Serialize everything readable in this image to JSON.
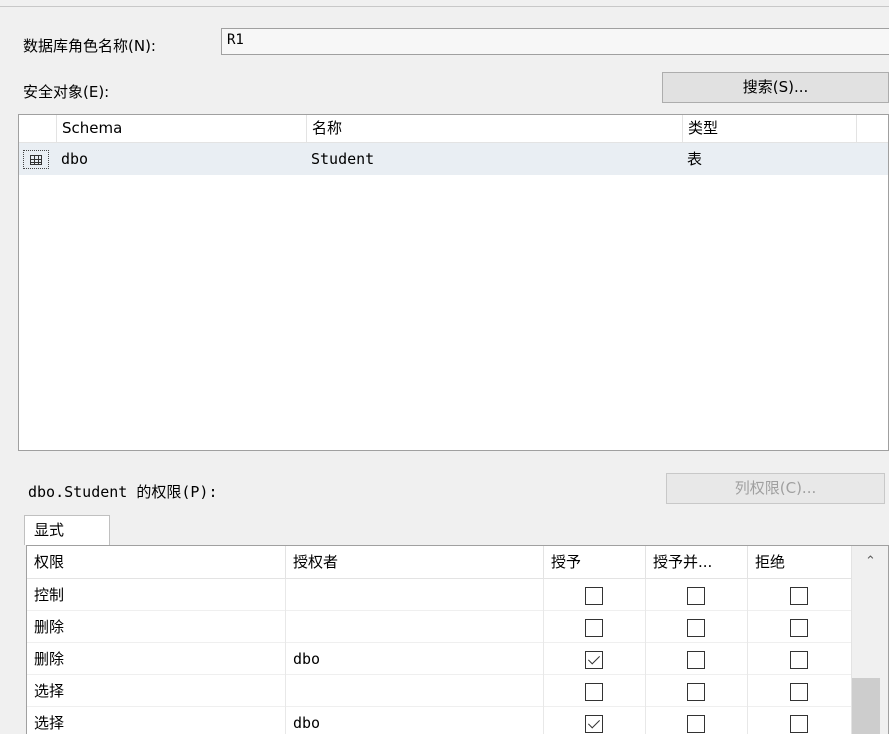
{
  "role": {
    "label": "数据库角色名称(N):",
    "value": "R1"
  },
  "securables": {
    "label": "安全对象(E):",
    "search_button": "搜索(S)...",
    "columns": [
      "Schema",
      "名称",
      "类型"
    ],
    "rows": [
      {
        "schema": "dbo",
        "name": "Student",
        "type": "表",
        "icon": "table-icon"
      }
    ]
  },
  "permissions": {
    "label": "dbo.Student 的权限(P):",
    "column_permissions_button": "列权限(C)...",
    "tab": "显式",
    "columns": [
      "权限",
      "授权者",
      "授予",
      "授予并...",
      "拒绝"
    ],
    "rows": [
      {
        "permission": "控制",
        "grantor": "",
        "grant": false,
        "with_grant": false,
        "deny": false
      },
      {
        "permission": "删除",
        "grantor": "",
        "grant": false,
        "with_grant": false,
        "deny": false
      },
      {
        "permission": "删除",
        "grantor": "dbo",
        "grant": true,
        "with_grant": false,
        "deny": false
      },
      {
        "permission": "选择",
        "grantor": "",
        "grant": false,
        "with_grant": false,
        "deny": false
      },
      {
        "permission": "选择",
        "grantor": "dbo",
        "grant": true,
        "with_grant": false,
        "deny": false
      }
    ]
  }
}
